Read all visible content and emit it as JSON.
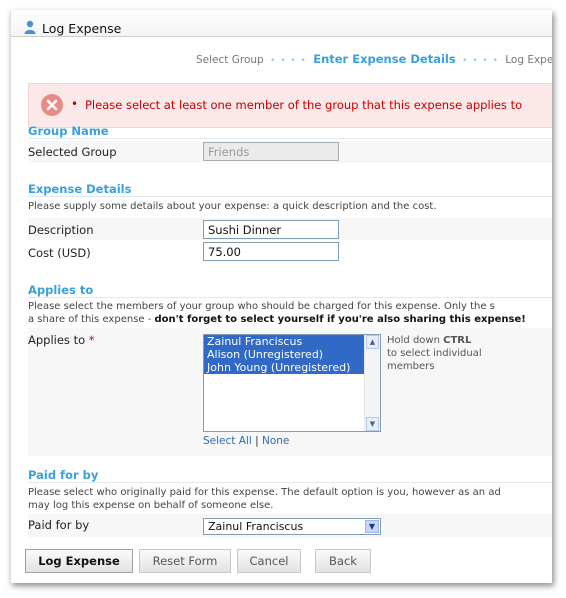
{
  "window": {
    "title": "Log Expense"
  },
  "steps": {
    "items": [
      "Select Group",
      "Enter Expense Details",
      "Log Expense"
    ],
    "dots": "• • • •"
  },
  "error": {
    "message": "Please select at least one member of the group that this expense applies to",
    "bullet": "•"
  },
  "group": {
    "heading": "Group Name",
    "label": "Selected Group",
    "value": "Friends"
  },
  "details": {
    "heading": "Expense Details",
    "description_text": "Please supply some details about your expense: a quick description and the cost.",
    "description_label": "Description",
    "description_value": "Sushi Dinner",
    "cost_label": "Cost (USD)",
    "cost_value": "75.00"
  },
  "applies": {
    "heading": "Applies to",
    "desc_line1": "Please select the members of your group who should be charged for this expense. Only the s",
    "desc_line2_plain": "a share of this expense - ",
    "desc_line2_bold": "don't forget to select yourself if you're also sharing this expense!",
    "label": "Applies to",
    "required": "*",
    "members": [
      "Zainul Franciscus",
      "Alison (Unregistered)",
      "John Young (Unregistered)"
    ],
    "hint_prefix": "Hold down ",
    "hint_key": "CTRL",
    "hint_rest": "to select individual members",
    "select_all": "Select All",
    "separator": "|",
    "none": "None"
  },
  "paid": {
    "heading": "Paid for by",
    "desc_line1": "Please select who originally paid for this expense. The default option is you, however as an ad",
    "desc_line2": "may log this expense on behalf of someone else.",
    "label": "Paid for by",
    "selected": "Zainul Franciscus"
  },
  "buttons": {
    "log": "Log Expense",
    "reset": "Reset Form",
    "cancel": "Cancel",
    "back": "Back"
  },
  "colors": {
    "accent": "#3aa0d8",
    "error": "#c40000",
    "selection": "#3169c6"
  },
  "icons": {
    "title": "user-icon",
    "error": "close-circle-icon"
  }
}
